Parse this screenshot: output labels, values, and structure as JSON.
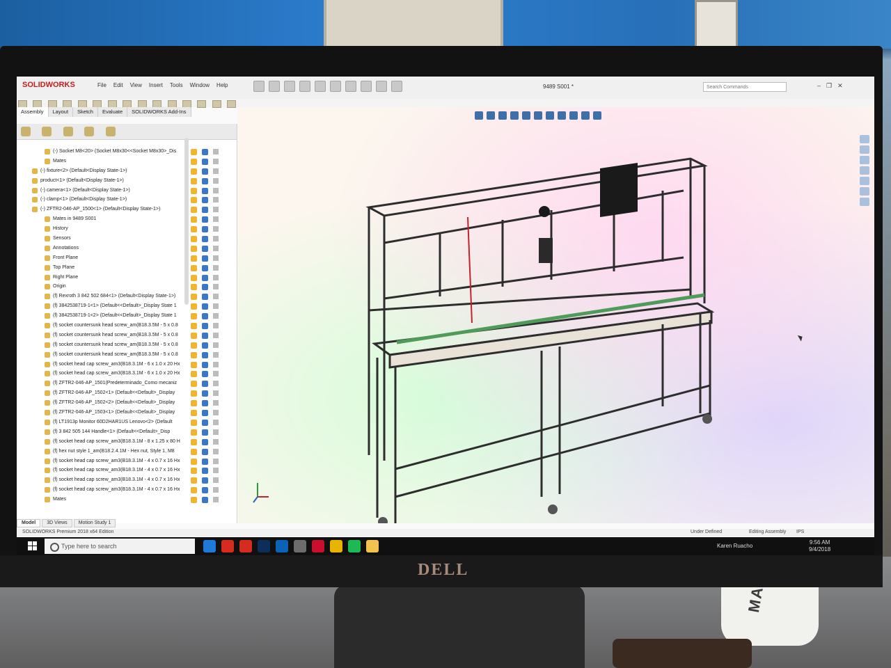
{
  "app": {
    "logo": "SOLIDWORKS",
    "menu": [
      "File",
      "Edit",
      "View",
      "Insert",
      "Tools",
      "Window",
      "Help"
    ],
    "document_title": "9489 S001 *",
    "search_placeholder": "Search Commands",
    "window_controls": [
      "–",
      "❐",
      "✕"
    ]
  },
  "command_tabs": [
    "Assembly",
    "Layout",
    "Sketch",
    "Evaluate",
    "SOLIDWORKS Add-Ins"
  ],
  "feature_tree": [
    {
      "label": "(-) Socket M8<20> (Socket M8x30<<Socket M8x30>_Dis",
      "indent": 2
    },
    {
      "label": "Mates",
      "indent": 2
    },
    {
      "label": "(-) fixture<2> (Default<Display State-1>)",
      "indent": 1
    },
    {
      "label": "product<1> (Default<Display State-1>)",
      "indent": 1
    },
    {
      "label": "(-) camera<1> (Default<Display State-1>)",
      "indent": 1
    },
    {
      "label": "(-) clamp<1> (Default<Display State-1>)",
      "indent": 1
    },
    {
      "label": "(-) ZFTR2-046-AP_1500<1> (Default<Display State-1>)",
      "indent": 1
    },
    {
      "label": "Mates in 9489 S001",
      "indent": 2
    },
    {
      "label": "History",
      "indent": 2
    },
    {
      "label": "Sensors",
      "indent": 2
    },
    {
      "label": "Annotations",
      "indent": 2
    },
    {
      "label": "Front Plane",
      "indent": 2
    },
    {
      "label": "Top Plane",
      "indent": 2
    },
    {
      "label": "Right Plane",
      "indent": 2
    },
    {
      "label": "Origin",
      "indent": 2
    },
    {
      "label": "(f) Rexroth 3 842 502 684<1> (Default<Display State-1>)",
      "indent": 2
    },
    {
      "label": "(f) 3842538719-1<1> (Default<<Default>_Display State 1",
      "indent": 2
    },
    {
      "label": "(f) 3842538719-1<2> (Default<<Default>_Display State 1",
      "indent": 2
    },
    {
      "label": "(f) socket countersunk head screw_am(B18.3.5M - 5 x 0.8",
      "indent": 2
    },
    {
      "label": "(f) socket countersunk head screw_am(B18.3.5M - 5 x 0.8",
      "indent": 2
    },
    {
      "label": "(f) socket countersunk head screw_am(B18.3.5M - 5 x 0.8",
      "indent": 2
    },
    {
      "label": "(f) socket countersunk head screw_am(B18.3.5M - 5 x 0.8",
      "indent": 2
    },
    {
      "label": "(f) socket head cap screw_am3(B18.3.1M - 6 x 1.0 x 20 Hx",
      "indent": 2
    },
    {
      "label": "(f) socket head cap screw_am3(B18.3.1M - 6 x 1.0 x 20 Hx",
      "indent": 2
    },
    {
      "label": "(f) ZFTR2-046-AP_1501(Predeterminado_Como mecaniz",
      "indent": 2
    },
    {
      "label": "(f) ZFTR2-046-AP_1502<1> (Default<<Default>_Display",
      "indent": 2
    },
    {
      "label": "(f) ZFTR2-046-AP_1502<2> (Default<<Default>_Display",
      "indent": 2
    },
    {
      "label": "(f) ZFTR2-046-AP_1503<1> (Default<<Default>_Display",
      "indent": 2
    },
    {
      "label": "(f) LT1913p Monitor 60D2HAR1US Lenovo<2> (Default",
      "indent": 2
    },
    {
      "label": "(f) 3 842 505 144 Handle<1> (Default<<Default>_Disp",
      "indent": 2
    },
    {
      "label": "(f) socket head cap screw_am3(B18.3.1M - 8 x 1.25 x 80 H",
      "indent": 2
    },
    {
      "label": "(f) hex nut style 1_am(B18.2.4.1M - Hex nut, Style 1, M8",
      "indent": 2
    },
    {
      "label": "(f) socket head cap screw_am3(B18.3.1M - 4 x 0.7 x 16 Hx",
      "indent": 2
    },
    {
      "label": "(f) socket head cap screw_am3(B18.3.1M - 4 x 0.7 x 16 Hx",
      "indent": 2
    },
    {
      "label": "(f) socket head cap screw_am3(B18.3.1M - 4 x 0.7 x 16 Hx",
      "indent": 2
    },
    {
      "label": "(f) socket head cap screw_am3(B18.3.1M - 4 x 0.7 x 16 Hx",
      "indent": 2
    },
    {
      "label": "Mates",
      "indent": 2
    }
  ],
  "bottom_tabs": [
    "Model",
    "3D Views",
    "Motion Study 1"
  ],
  "status": {
    "edition": "SOLIDWORKS Premium 2018 x64 Edition",
    "state": "Under Defined",
    "mode": "Editing Assembly",
    "units": "IPS"
  },
  "taskbar": {
    "search_placeholder": "Type here to search",
    "user": "Karen Ruacho",
    "time": "9:56 AM",
    "date": "9/4/2018",
    "app_icons": [
      "edge-icon",
      "acrobat-icon",
      "acrobat-reader-icon",
      "photoshop-icon",
      "outlook-icon",
      "store-icon",
      "solidworks-icon",
      "chrome-icon",
      "spotify-icon",
      "file-explorer-icon"
    ],
    "app_colors": [
      "#1e7ad6",
      "#d62b1f",
      "#d62b1f",
      "#0b2e5a",
      "#0a64b5",
      "#6c6c6c",
      "#c8102e",
      "#e8b400",
      "#1db954",
      "#f2c14e"
    ]
  },
  "monitor": {
    "brand": "DELL"
  },
  "background": {
    "mug_text": "MAS"
  }
}
